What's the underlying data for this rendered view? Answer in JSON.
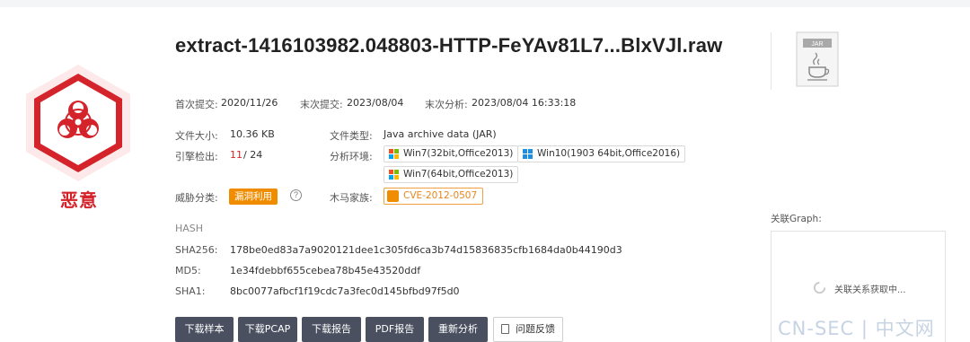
{
  "verdict": "恶意",
  "file_title": "extract-1416103982.048803-HTTP-FeYAv81L7...BlxVJl.raw",
  "file_icon_text": "JAR",
  "dates": {
    "first_submit_label": "首次提交:",
    "first_submit_value": "2020/11/26",
    "last_submit_label": "末次提交:",
    "last_submit_value": "2023/08/04",
    "last_analysis_label": "末次分析:",
    "last_analysis_value": "2023/08/04 16:33:18"
  },
  "info": {
    "size_label": "文件大小:",
    "size_value": "10.36 KB",
    "engine_label": "引擎检出:",
    "engine_detected": "11",
    "engine_total": "/ 24",
    "threat_label": "威胁分类:",
    "threat_tag": "漏洞利用",
    "help_glyph": "?",
    "type_label": "文件类型:",
    "type_value": "Java archive data (JAR)",
    "env_label": "分析环境:",
    "envs": [
      "Win7(32bit,Office2013)",
      "Win10(1903 64bit,Office2016)",
      "Win7(64bit,Office2013)"
    ],
    "family_label": "木马家族:",
    "family_tag": "CVE-2012-0507"
  },
  "hash": {
    "section": "HASH",
    "sha256_label": "SHA256:",
    "sha256": "178be0ed83a7a9020121dee1c305fd6ca3b74d15836835cfb1684da0b44190d3",
    "md5_label": "MD5:",
    "md5": "1e34fdebbf655cebea78b45e43520ddf",
    "sha1_label": "SHA1:",
    "sha1": "8bc0077afbcf1f19cdc7a3fec0d145bfbd97f5d0"
  },
  "graph": {
    "label": "关联Graph:",
    "loading": "关联关系获取中..."
  },
  "buttons": [
    "下载样本",
    "下载PCAP",
    "下载报告",
    "PDF报告",
    "重新分析",
    "问题反馈"
  ],
  "watermark": "CN-SEC | 中文网",
  "colors": {
    "malicious_red": "#d4232a",
    "tag_orange": "#f08c00",
    "button_dark": "#4a5060"
  }
}
